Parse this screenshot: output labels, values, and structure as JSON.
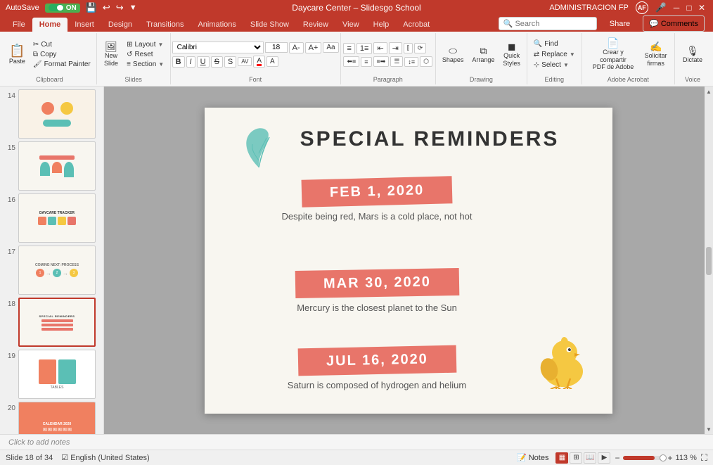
{
  "titlebar": {
    "autosave_label": "AutoSave",
    "autosave_state": "ON",
    "title": "Daycare Center – Slidesgo School",
    "user": "ADMINISTRACION FP",
    "user_initials": "AF"
  },
  "ribbon": {
    "tabs": [
      "File",
      "Home",
      "Insert",
      "Design",
      "Transitions",
      "Animations",
      "Slide Show",
      "Review",
      "View",
      "Help",
      "Acrobat"
    ],
    "active_tab": "Home",
    "groups": {
      "clipboard": {
        "label": "Clipboard",
        "buttons": [
          "Paste",
          "Cut",
          "Copy",
          "Format Painter"
        ]
      },
      "slides": {
        "label": "Slides",
        "buttons": [
          "New Slide",
          "Layout",
          "Reset",
          "Section"
        ]
      },
      "font": {
        "label": "Font",
        "font_name": "Calibri",
        "font_size": "18",
        "bold": "B",
        "italic": "I",
        "underline": "U",
        "strikethrough": "S"
      },
      "paragraph": {
        "label": "Paragraph"
      },
      "drawing": {
        "label": "Drawing",
        "buttons": [
          "Shapes",
          "Arrange",
          "Quick Styles"
        ]
      },
      "editing": {
        "label": "Editing",
        "buttons": [
          "Find",
          "Replace",
          "Select"
        ]
      },
      "adobe": {
        "label": "Adobe Acrobat",
        "buttons": [
          "Crear y compartir PDF de Adobe",
          "Solicitar firmas"
        ]
      },
      "voice": {
        "label": "Voice",
        "buttons": [
          "Dictate"
        ]
      }
    },
    "search_placeholder": "Search",
    "share_label": "Share",
    "comments_label": "Comments"
  },
  "slides": [
    {
      "num": "14",
      "active": false,
      "preview": "slide14"
    },
    {
      "num": "15",
      "active": false,
      "preview": "slide15"
    },
    {
      "num": "16",
      "active": false,
      "preview": "slide16"
    },
    {
      "num": "17",
      "active": false,
      "preview": "slide17"
    },
    {
      "num": "18",
      "active": true,
      "preview": "slide18"
    },
    {
      "num": "19",
      "active": false,
      "preview": "slide19"
    },
    {
      "num": "20",
      "active": false,
      "preview": "slide20"
    }
  ],
  "main_slide": {
    "title": "SPECIAL REMINDERS",
    "events": [
      {
        "date": "FEB 1, 2020",
        "description": "Despite being red, Mars is a cold place, not hot"
      },
      {
        "date": "MAR 30, 2020",
        "description": "Mercury is the closest planet to the Sun"
      },
      {
        "date": "JUL 16, 2020",
        "description": "Saturn is composed of hydrogen and helium"
      }
    ]
  },
  "notes": {
    "placeholder": "Click to add notes"
  },
  "statusbar": {
    "slide_info": "Slide 18 of 34",
    "language": "English (United States)",
    "zoom": "113 %",
    "notes_label": "Notes",
    "view_buttons": [
      "Normal",
      "Slide Sorter",
      "Reading View",
      "Slide Show"
    ]
  }
}
